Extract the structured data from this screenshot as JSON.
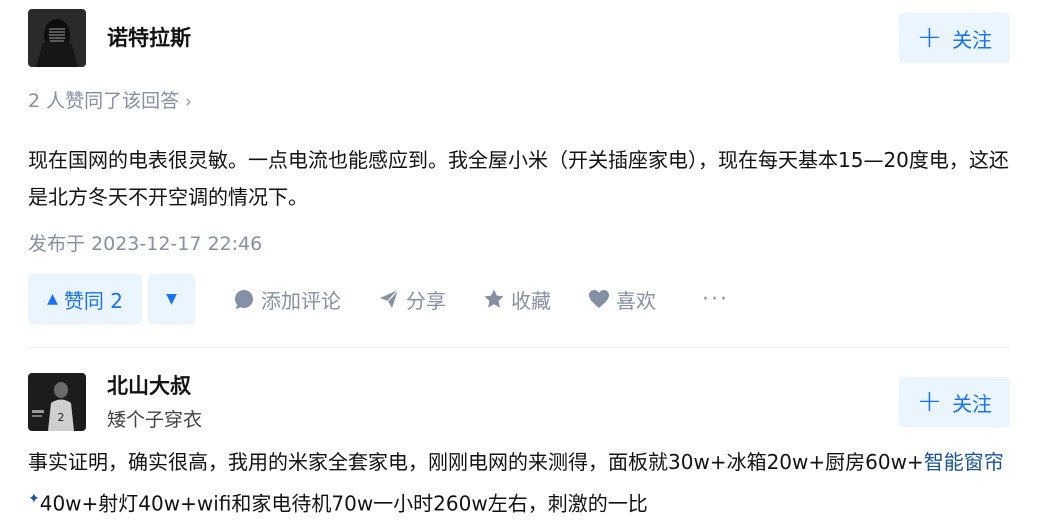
{
  "answers": [
    {
      "author": {
        "name": "诺特拉斯",
        "bio": ""
      },
      "follow_label": "关注",
      "voters_text": "2 人赞同了该回答",
      "content": "现在国网的电表很灵敏。一点电流也能感应到。我全屋小米（开关插座家电），现在每天基本15—20度电，这还是北方冬天不开空调的情况下。",
      "publish_time": "发布于 2023-12-17 22:46",
      "actions": {
        "vote_up": "赞同 2",
        "comment": "添加评论",
        "share": "分享",
        "collect": "收藏",
        "like": "喜欢",
        "more": "···"
      }
    },
    {
      "author": {
        "name": "北山大叔",
        "bio": "矮个子穿衣"
      },
      "follow_label": "关注",
      "content_before_link": "事实证明，确实很高，我用的米家全套家电，刚刚电网的来测得，面板就30w+冰箱20w+厨房60w+",
      "content_link": "智能窗帘",
      "content_after_link": "40w+射灯40w+wifi和家电待机70w一小时260w左右，刺激的一比"
    }
  ],
  "colors": {
    "accent": "#1772f6",
    "accent_bg": "#ebf5ff",
    "muted": "#8590a6",
    "text": "#121212",
    "link": "#175199"
  }
}
